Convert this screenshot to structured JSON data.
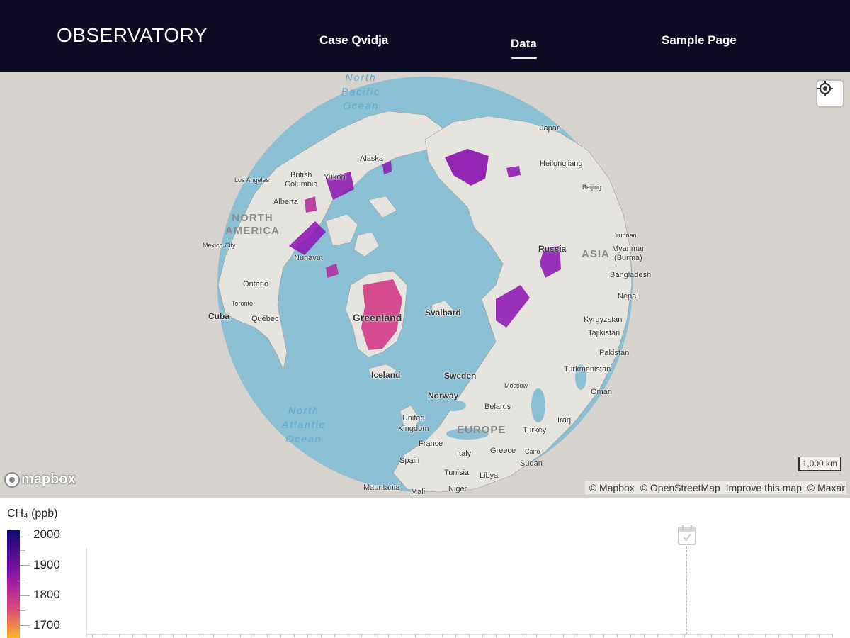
{
  "header": {
    "brand": "OBSERVATORY",
    "nav": [
      {
        "label": "Case Qvidja",
        "active": false
      },
      {
        "label": "Data",
        "active": true
      },
      {
        "label": "Sample Page",
        "active": false
      }
    ]
  },
  "map": {
    "labels": {
      "ocean_north_pacific": "North\nPacific\nOcean",
      "ocean_north_atlantic": "North\nAtlantic\nOcean",
      "north_america": "NORTH\nAMERICA",
      "asia": "ASIA",
      "europe": "EUROPE",
      "japan": "Japan",
      "heilongjiang": "Heilongjiang",
      "beijing": "Beijing",
      "alaska": "Alaska",
      "yukon": "Yukon",
      "british_columbia": "British\nColumbia",
      "los_angeles": "Los Angeles",
      "alberta": "Alberta",
      "mexico_city": "Mexico City",
      "nunavut": "Nunavut",
      "ontario": "Ontario",
      "toronto": "Toronto",
      "cuba": "Cuba",
      "quebec": "Québec",
      "greenland": "Greenland",
      "svalbard": "Svalbard",
      "russia": "Russia",
      "yunnan": "Yunnan",
      "myanmar": "Myanmar\n(Burma)",
      "bangladesh": "Bangladesh",
      "nepal": "Nepal",
      "kyrgyzstan": "Kyrgyzstan",
      "tajikistan": "Tajikistan",
      "pakistan": "Pakistan",
      "turkmenistan": "Turkmenistan",
      "oman": "Oman",
      "iceland": "Iceland",
      "sweden": "Sweden",
      "norway": "Norway",
      "moscow": "Moscow",
      "belarus": "Belarus",
      "united_kingdom": "United\nKingdom",
      "france": "France",
      "spain": "Spain",
      "italy": "Italy",
      "greece": "Greece",
      "cairo": "Cairo",
      "turkey": "Turkey",
      "iraq": "Iraq",
      "sudan": "Sudan",
      "tunisia": "Tunisia",
      "libya": "Libya",
      "mauritania": "Mauritania",
      "mali": "Mali",
      "niger": "Niger"
    },
    "scale_label": "1,000 km",
    "logo_text": "mapbox",
    "attribution": [
      "© Mapbox",
      "© OpenStreetMap",
      "Improve this map",
      "© Maxar"
    ]
  },
  "legend": {
    "title": "CH₄ (ppb)",
    "ticks": [
      "2000",
      "1900",
      "1800",
      "1700"
    ]
  },
  "colors": {
    "header_bg": "#0d0c24",
    "ocean": "#8bbfd3",
    "land": "#e6e4df",
    "methane_high": "#8a12b0",
    "methane_mid": "#d13a86"
  }
}
